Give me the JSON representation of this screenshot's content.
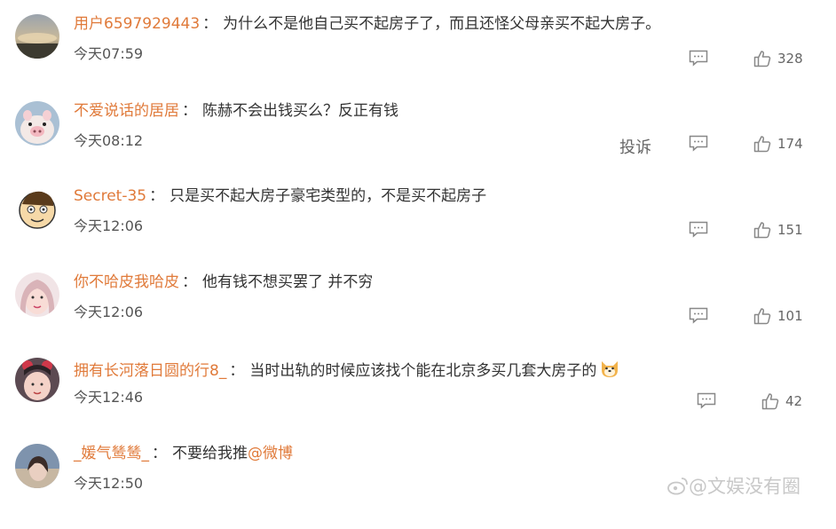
{
  "comments": [
    {
      "user": "用户6597929443",
      "text": "为什么不是他自己买不起房子了，而且还怪父母亲买不起大房子。",
      "time": "今天07:59",
      "likes": "328"
    },
    {
      "user": "不爱说话的居居",
      "text": "陈赫不会出钱买么？反正有钱",
      "time": "今天08:12",
      "likes": "174",
      "report": "投诉"
    },
    {
      "user": "Secret-35",
      "text": "只是买不起大房子豪宅类型的，不是买不起房子",
      "time": "今天12:06",
      "likes": "151"
    },
    {
      "user": "你不哈皮我哈皮",
      "text": "他有钱不想买罢了 并不穷",
      "time": "今天12:06",
      "likes": "101"
    },
    {
      "user": "拥有长河落日圆的行8_",
      "text": "当时出轨的时候应该找个能在北京多买几套大房子的",
      "time": "今天12:46",
      "likes": "42"
    },
    {
      "user": "_媛气鸶鸶_",
      "text": "不要给我推",
      "mention": "@微博",
      "time": "今天12:50"
    }
  ],
  "separator": "：",
  "watermark": "@文娱没有圈",
  "colors": {
    "username": "#e07a3a",
    "text": "#333333",
    "time": "#555555",
    "icon": "#888888"
  },
  "icons": {
    "reply": "comment-icon",
    "like": "thumbs-up-icon",
    "emoji": "dog-face-emoji",
    "watermark": "weibo-logo-icon"
  }
}
